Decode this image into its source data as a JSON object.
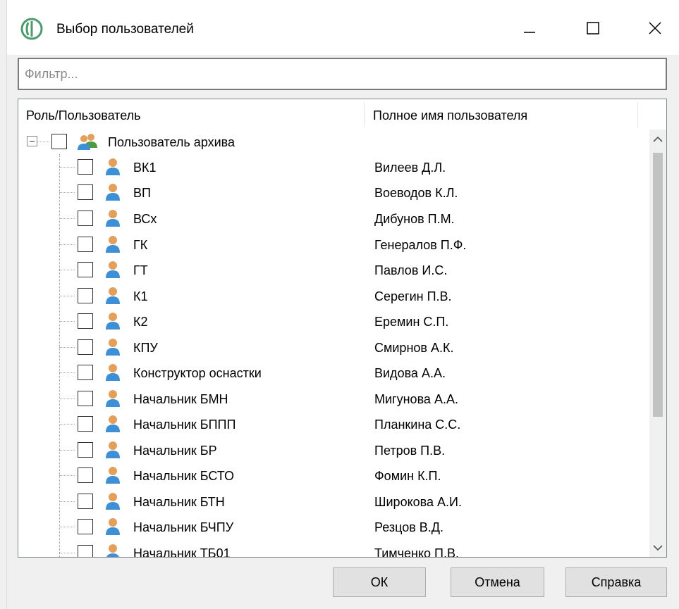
{
  "window": {
    "title": "Выбор пользователей",
    "app_icon": "app-logo-icon",
    "controls": [
      "minimize-icon",
      "maximize-icon",
      "close-icon"
    ]
  },
  "filter": {
    "placeholder": "Фильтр...",
    "value": ""
  },
  "tree": {
    "columns": [
      "Роль/Пользователь",
      "Полное имя пользователя"
    ],
    "group": {
      "label": "Пользователь архива",
      "icon": "user-group-icon",
      "checked": false,
      "expanded": true
    },
    "rows": [
      {
        "role": "ВК1",
        "full_name": "Вилеев Д.Л."
      },
      {
        "role": "ВП",
        "full_name": "Воеводов К.Л."
      },
      {
        "role": "ВСх",
        "full_name": "Дибунов П.М."
      },
      {
        "role": "ГК",
        "full_name": "Генералов П.Ф."
      },
      {
        "role": "ГТ",
        "full_name": "Павлов И.С."
      },
      {
        "role": "К1",
        "full_name": "Серегин П.В."
      },
      {
        "role": "К2",
        "full_name": "Еремин С.П."
      },
      {
        "role": "КПУ",
        "full_name": "Смирнов А.К."
      },
      {
        "role": "Конструктор оснастки",
        "full_name": "Видова А.А."
      },
      {
        "role": "Начальник БМН",
        "full_name": "Мигунова А.А."
      },
      {
        "role": "Начальник БППП",
        "full_name": "Планкина С.С."
      },
      {
        "role": "Начальник БР",
        "full_name": "Петров П.В."
      },
      {
        "role": "Начальник БСТО",
        "full_name": "Фомин К.П."
      },
      {
        "role": "Начальник БТН",
        "full_name": "Широкова А.И."
      },
      {
        "role": "Начальник БЧПУ",
        "full_name": "Резцов В.Д."
      },
      {
        "role": "Начальник ТБ01",
        "full_name": "Тимченко П.В."
      }
    ]
  },
  "buttons": {
    "ok": "ОК",
    "cancel": "Отмена",
    "help": "Справка"
  },
  "colors": {
    "user_icon_body": "#3d8fd6",
    "user_icon_head": "#e4a05a",
    "logo": "#5aa05a"
  }
}
